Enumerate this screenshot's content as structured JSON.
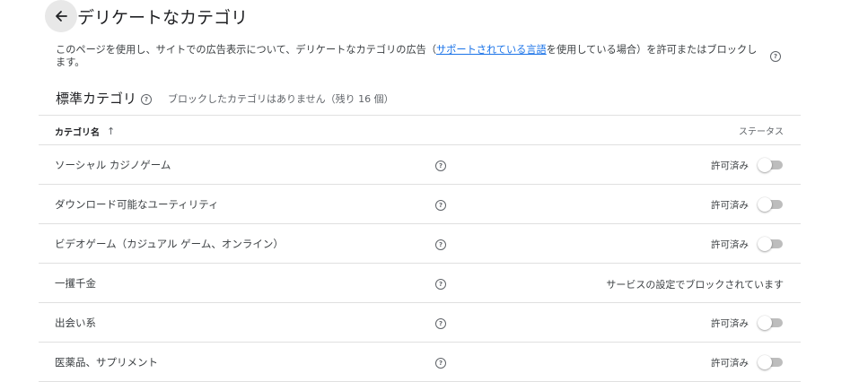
{
  "header": {
    "title": "デリケートなカテゴリ"
  },
  "description": {
    "before_link": "このページを使用し、サイトでの広告表示について、デリケートなカテゴリの広告（",
    "link_text": "サポートされている言語",
    "after_link": "を使用している場合）を許可またはブロックします。"
  },
  "section": {
    "title": "標準カテゴリ",
    "status": "ブロックしたカテゴリはありません（残り 16 個）"
  },
  "table": {
    "col_name": "カテゴリ名",
    "col_status": "ステータス",
    "rows": [
      {
        "name": "ソーシャル カジノゲーム",
        "status": "許可済み",
        "blocked": false
      },
      {
        "name": "ダウンロード可能なユーティリティ",
        "status": "許可済み",
        "blocked": false
      },
      {
        "name": "ビデオゲーム（カジュアル ゲーム、オンライン）",
        "status": "許可済み",
        "blocked": false
      },
      {
        "name": "一攫千金",
        "status": "サービスの設定でブロックされています",
        "blocked": true
      },
      {
        "name": "出会い系",
        "status": "許可済み",
        "blocked": false
      },
      {
        "name": "医薬品、サプリメント",
        "status": "許可済み",
        "blocked": false
      }
    ]
  },
  "icons": {
    "back": "arrow-back-icon",
    "help": "help-circle-icon",
    "sort": "arrow-up-icon"
  },
  "colors": {
    "link": "#1a73e8",
    "divider": "#e0e0e0",
    "toggle_off": "#bdbdbd"
  }
}
